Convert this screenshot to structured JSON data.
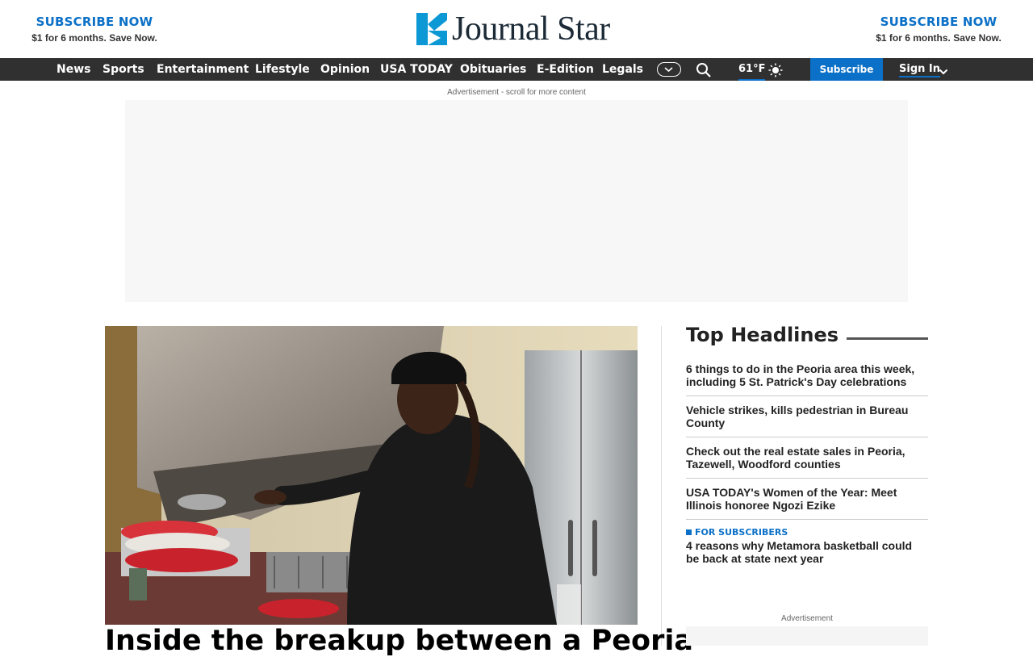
{
  "promo": {
    "left": {
      "cta": "SUBSCRIBE NOW",
      "sub": "$1 for 6 months. Save Now."
    },
    "right": {
      "cta": "SUBSCRIBE NOW",
      "sub": "$1 for 6 months. Save Now."
    }
  },
  "brand": {
    "name": "Journal Star",
    "accent": "#0b98d4"
  },
  "nav": {
    "items": [
      "News",
      "Sports",
      "Entertainment",
      "Lifestyle",
      "Opinion",
      "USA TODAY",
      "Obituaries",
      "E-Edition",
      "Legals"
    ],
    "weather": "61°F",
    "subscribe": "Subscribe",
    "signin": "Sign In"
  },
  "ad": {
    "label": "Advertisement - scroll for more content"
  },
  "hero": {
    "title": "Inside the breakup between a Peoria"
  },
  "sidebar": {
    "title": "Top Headlines",
    "headlines": [
      {
        "text": "6 things to do in the Peoria area this week, including 5 St. Patrick's Day celebrations"
      },
      {
        "text": "Vehicle strikes, kills pedestrian in Bureau County"
      },
      {
        "text": "Check out the real estate sales in Peoria, Tazewell, Woodford counties"
      },
      {
        "text": "USA TODAY's Women of the Year: Meet Illinois honoree Ngozi Ezike"
      },
      {
        "badge": "FOR SUBSCRIBERS",
        "text": "4 reasons why Metamora basketball could be back at state next year"
      }
    ],
    "ad_label": "Advertisement"
  },
  "colors": {
    "accent": "#0b70c7",
    "nav_bg": "#303030"
  }
}
